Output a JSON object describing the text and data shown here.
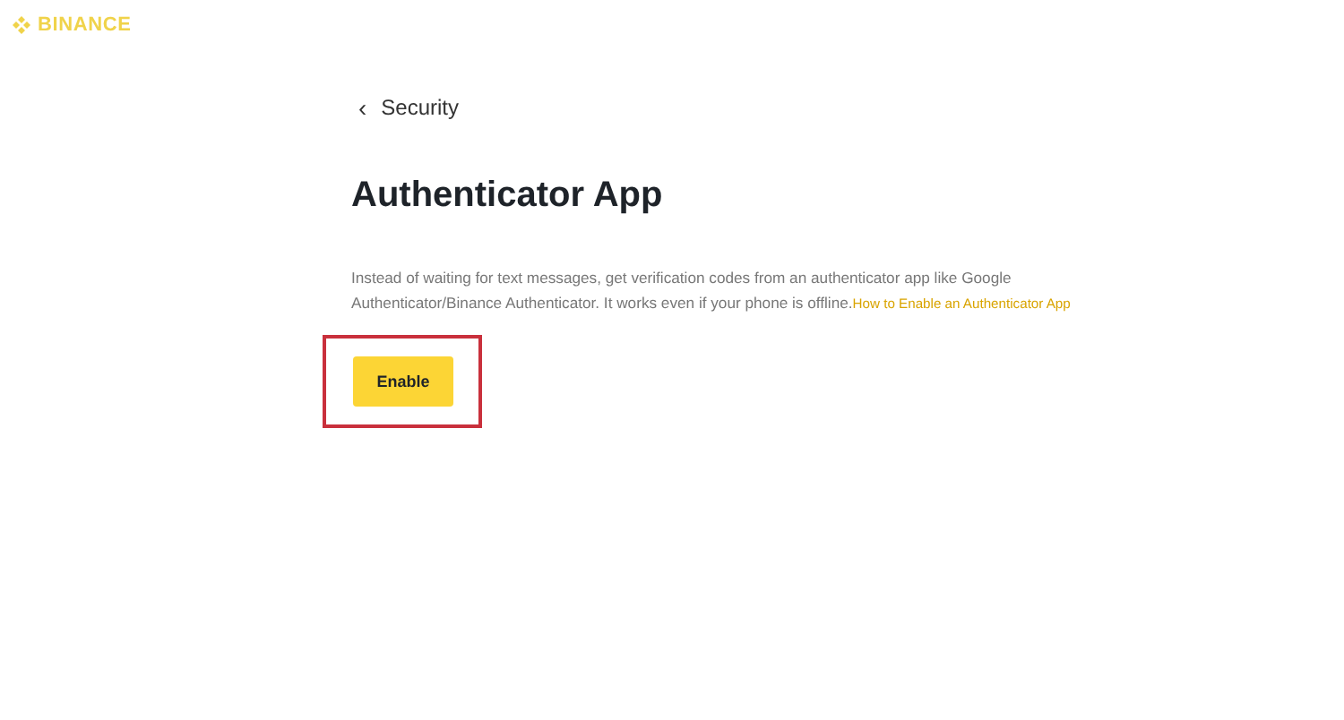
{
  "header": {
    "logo_text": "BINANCE"
  },
  "back_link": {
    "icon": "‹",
    "label": "Security"
  },
  "title": "Authenticator App",
  "description": {
    "text": "Instead of waiting for text messages, get verification codes from an authenticator app like Google Authenticator/Binance Authenticator. It works even if your phone is offline.",
    "link": "How to Enable an Authenticator App"
  },
  "enable_button": {
    "label": "Enable"
  }
}
